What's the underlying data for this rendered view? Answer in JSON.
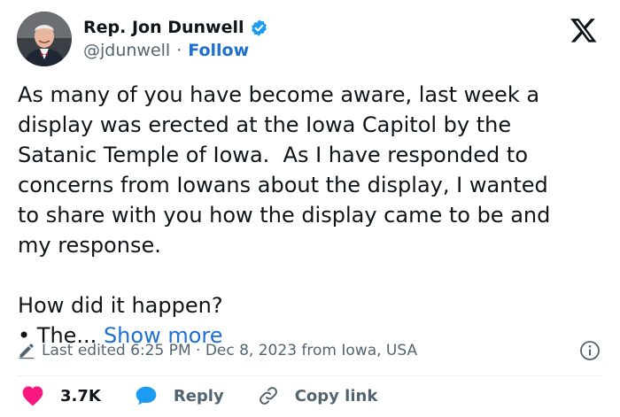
{
  "author": {
    "name": "Rep. Jon Dunwell",
    "handle": "@jdunwell",
    "separator": "·",
    "follow_label": "Follow"
  },
  "icons": {
    "avatar": "profile-photo",
    "verified": "verified-badge-icon",
    "logo": "x-logo",
    "edit": "pencil-icon",
    "info": "info-icon",
    "like": "heart-icon",
    "reply": "speech-bubble-icon",
    "copy": "link-icon"
  },
  "tweet": {
    "text": "As many of you have become aware, last week a\ndisplay was erected at the Iowa Capitol by the\nSatanic Temple of Iowa.  As I have responded to\nconcerns from Iowans about the display, I wanted\nto share with you how the display came to be and\nmy response.\n\nHow did it happen?\n• The... ",
    "show_more": "Show more"
  },
  "meta": {
    "text": "Last edited 6:25 PM · Dec 8, 2023 from Iowa, USA"
  },
  "actions": {
    "likes": "3.7K",
    "reply": "Reply",
    "copy_link": "Copy link"
  },
  "colors": {
    "accent": "#1d6fd1",
    "like": "#f91880",
    "verified": "#1d9bf0",
    "muted": "#536471"
  }
}
